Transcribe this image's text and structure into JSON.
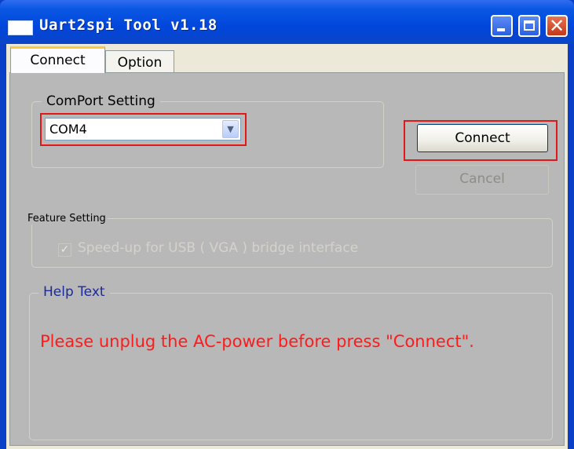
{
  "window": {
    "title": "Uart2spi Tool v1.18",
    "controls": {
      "minimize_icon": "minimize-icon",
      "maximize_icon": "maximize-icon",
      "close_icon": "close-icon",
      "close_glyph": "✕"
    }
  },
  "tabs": [
    {
      "label": "Connect",
      "active": true
    },
    {
      "label": "Option",
      "active": false
    }
  ],
  "comport": {
    "group_label": "ComPort Setting",
    "selected": "COM4",
    "arrow_glyph": "▼"
  },
  "buttons": {
    "connect": "Connect",
    "cancel": "Cancel"
  },
  "feature": {
    "group_label": "Feature Setting",
    "checkbox_label": "Speed-up for USB ( VGA ) bridge interface",
    "checked": true,
    "check_glyph": "✓"
  },
  "help": {
    "group_label": "Help Text",
    "message": "Please unplug the AC-power before press \"Connect\"."
  },
  "colors": {
    "titlebar": "#0046dc",
    "panel": "#b8b8b8",
    "highlight": "#e01818",
    "help_text": "#ff1b1b",
    "help_label": "#1c2a9c"
  }
}
